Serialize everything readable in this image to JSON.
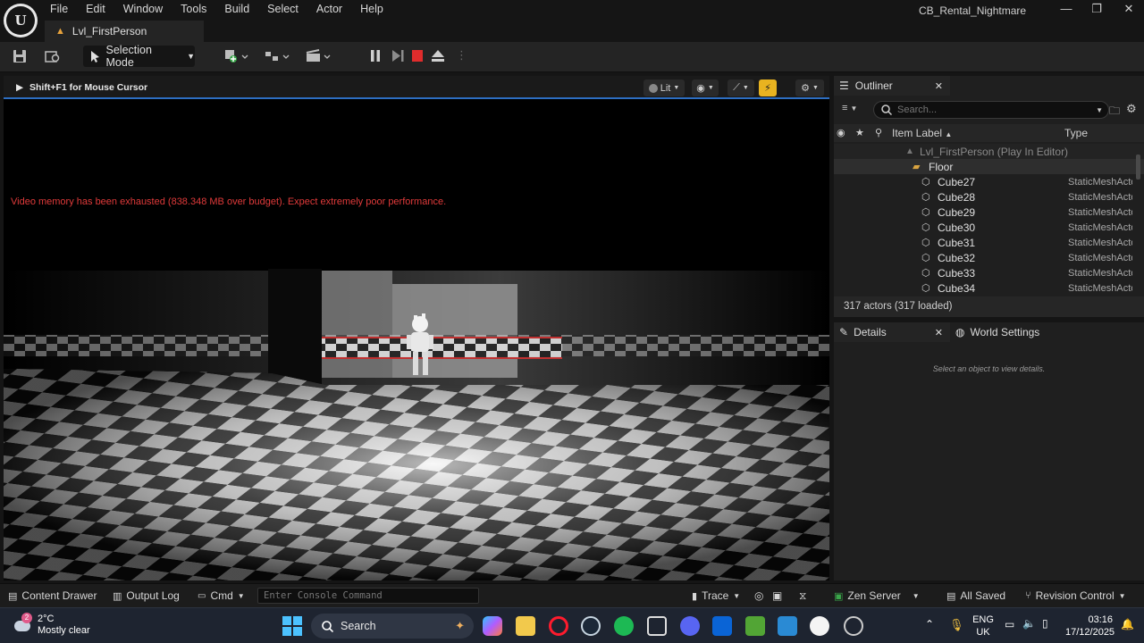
{
  "app": {
    "project_name": "CB_Rental_Nightmare",
    "menu": [
      "File",
      "Edit",
      "Window",
      "Tools",
      "Build",
      "Select",
      "Actor",
      "Help"
    ],
    "level_tab": "Lvl_FirstPerson"
  },
  "toolbar": {
    "mode_label": "Selection Mode"
  },
  "viewport": {
    "hint": "Shift+F1 for Mouse Cursor",
    "view_mode": "Lit",
    "warning": "Video memory has been exhausted (838.348 MB over budget). Expect extremely poor performance."
  },
  "outliner": {
    "tab_label": "Outliner",
    "search_placeholder": "Search...",
    "col_label": "Item Label",
    "col_type": "Type",
    "root": "Lvl_FirstPerson (Play In Editor)",
    "folder": "Floor",
    "items": [
      {
        "label": "Cube27",
        "type": "StaticMeshActor"
      },
      {
        "label": "Cube28",
        "type": "StaticMeshActor"
      },
      {
        "label": "Cube29",
        "type": "StaticMeshActor"
      },
      {
        "label": "Cube30",
        "type": "StaticMeshActor"
      },
      {
        "label": "Cube31",
        "type": "StaticMeshActor"
      },
      {
        "label": "Cube32",
        "type": "StaticMeshActor"
      },
      {
        "label": "Cube33",
        "type": "StaticMeshActor"
      },
      {
        "label": "Cube34",
        "type": "StaticMeshActor"
      }
    ],
    "actor_count": "317 actors (317 loaded)"
  },
  "details": {
    "tab_label": "Details",
    "world_tab": "World Settings",
    "empty_text": "Select an object to view details."
  },
  "statusbar": {
    "content_drawer": "Content Drawer",
    "output_log": "Output Log",
    "cmd": "Cmd",
    "console_placeholder": "Enter Console Command",
    "trace": "Trace",
    "zen_server": "Zen Server",
    "all_saved": "All Saved",
    "revision_control": "Revision Control"
  },
  "taskbar": {
    "weather_temp": "2°C",
    "weather_desc": "Mostly clear",
    "weather_badge": "2",
    "search_label": "Search",
    "lang_line1": "ENG",
    "lang_line2": "UK",
    "time": "03:16",
    "date": "17/12/2025"
  },
  "colors": {
    "accent_blue": "#2d6ec2",
    "warning_red": "#e03a3a",
    "stop_red": "#e02c2c",
    "highlight_yellow": "#e8b320"
  }
}
